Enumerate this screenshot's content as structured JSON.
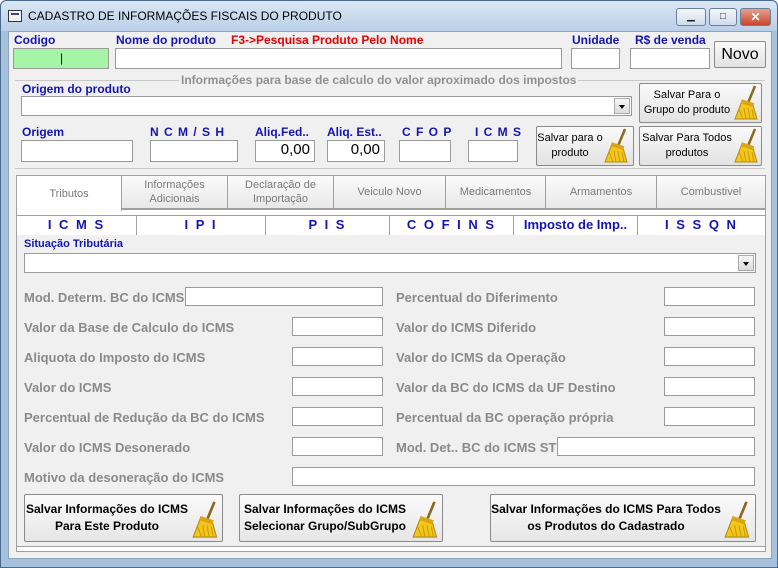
{
  "window": {
    "title": "CADASTRO DE INFORMAÇÕES FISCAIS DO PRODUTO",
    "controls": {
      "minimize": "▁",
      "maximize": "□",
      "close": "✕"
    }
  },
  "header": {
    "codigo_label": "Codigo",
    "codigo_value": "|",
    "nome_label": "Nome do produto",
    "hint": "F3->Pesquisa Produto Pelo Nome",
    "nome_value": "",
    "unidade_label": "Unidade",
    "unidade_value": "",
    "venda_label": "R$ de venda",
    "venda_value": "",
    "novo_label": "Novo"
  },
  "impostos": {
    "group_title": "Informações para base de calculo do valor aproximado dos impostos",
    "origem_produto_label": "Origem  do produto",
    "origem_produto_value": "",
    "salvar_grupo_label": "Salvar Para o Grupo do produto",
    "origem_label": "Origem",
    "ncm_label": "N C M / S H",
    "aliq_fed_label": "Aliq.Fed..",
    "aliq_fed_value": "0,00",
    "aliq_est_label": "Aliq. Est..",
    "aliq_est_value": "0,00",
    "cfop_label": "C F O P",
    "icms_label": "I C M S",
    "salvar_produto_label": "Salvar  para o produto",
    "salvar_todos_label": "Salvar Para Todos produtos"
  },
  "tabs": [
    {
      "label": "Tributos"
    },
    {
      "label": "Informações Adicionais"
    },
    {
      "label": "Declaração de Importação"
    },
    {
      "label": "Veiculo Novo"
    },
    {
      "label": "Medicamentos"
    },
    {
      "label": "Armamentos"
    },
    {
      "label": "Combustivel"
    }
  ],
  "subtabs": [
    {
      "label": "I C M S"
    },
    {
      "label": "I P I"
    },
    {
      "label": "P I S"
    },
    {
      "label": "C O F I N S"
    },
    {
      "label": "Imposto de Imp.."
    },
    {
      "label": "I S S Q N"
    }
  ],
  "icms": {
    "situacao_label": "Situação Tributária",
    "situacao_value": "",
    "left_fields": [
      {
        "label": "Mod. Determ. BC do ICMS"
      },
      {
        "label": "Valor da Base de Calculo do ICMS"
      },
      {
        "label": "Aliquota do Imposto do ICMS"
      },
      {
        "label": "Valor do ICMS"
      },
      {
        "label": "Percentual de Redução da BC do ICMS"
      },
      {
        "label": "Valor do ICMS Desonerado"
      }
    ],
    "right_fields": [
      {
        "label": "Percentual do Diferimento"
      },
      {
        "label": "Valor do ICMS Diferido"
      },
      {
        "label": "Valor do ICMS da Operação"
      },
      {
        "label": "Valor da BC do ICMS da UF Destino"
      },
      {
        "label": "Percentual da BC operação própria"
      },
      {
        "label": "Mod. Det.. BC do ICMS ST"
      }
    ],
    "motivo_label": "Motivo da desoneração do ICMS",
    "btn_produto": "Salvar Informações do ICMS Para Este Produto",
    "btn_grupo": "Salvar Informações do ICMS Selecionar Grupo/SubGrupo",
    "btn_todos": "Salvar Informações do ICMS Para Todos os Produtos do Cadastrado"
  },
  "icons": {
    "broom": "broom-icon",
    "window": "form-icon"
  },
  "colors": {
    "label_blue": "#1414b4",
    "hint_red": "#e60000",
    "field_green": "#a6f5a6"
  }
}
